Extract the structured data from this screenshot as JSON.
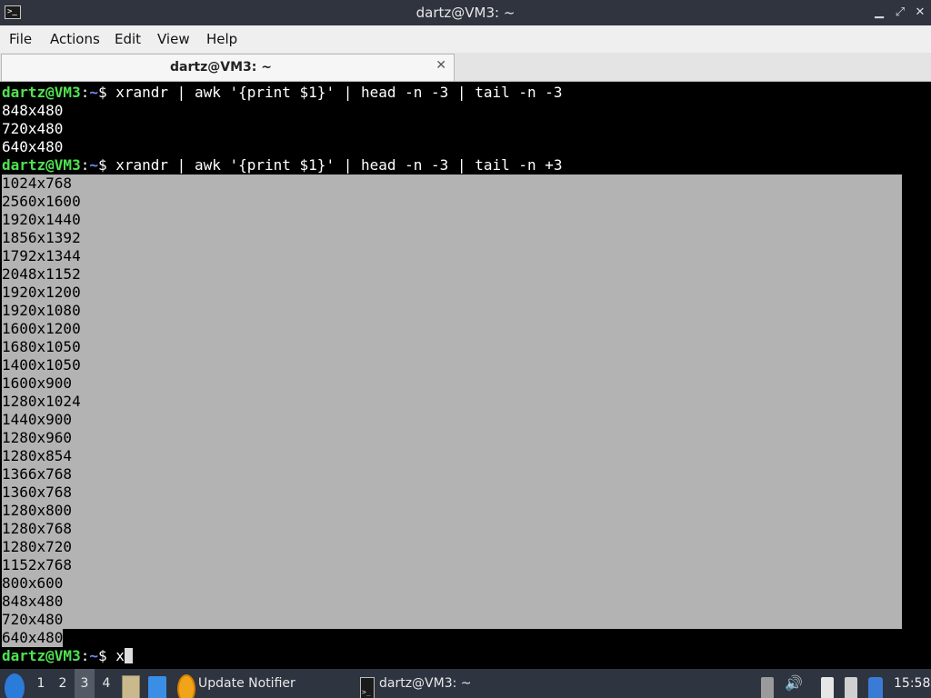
{
  "window": {
    "title": "dartz@VM3: ~",
    "controls": {
      "minimize": "▁",
      "restore": "⤢",
      "close": "✕"
    }
  },
  "menubar": {
    "items": [
      "File",
      "Actions",
      "Edit",
      "View",
      "Help"
    ]
  },
  "tabs": [
    {
      "title": "dartz@VM3: ~",
      "close": "✕"
    }
  ],
  "terminal": {
    "prompt": {
      "user_host": "dartz@VM3",
      "colon": ":",
      "dir": "~",
      "symbol": "$ "
    },
    "commands": [
      "xrandr | awk '{print $1}' | head -n -3 | tail -n -3",
      "xrandr | awk '{print $1}' | head -n -3 | tail -n +3",
      "x"
    ],
    "output1": [
      "848x480",
      "720x480",
      "640x480"
    ],
    "output2": [
      "1024x768",
      "2560x1600",
      "1920x1440",
      "1856x1392",
      "1792x1344",
      "2048x1152",
      "1920x1200",
      "1920x1080",
      "1600x1200",
      "1680x1050",
      "1400x1050",
      "1600x900",
      "1280x1024",
      "1440x900",
      "1280x960",
      "1280x854",
      "1366x768",
      "1360x768",
      "1280x800",
      "1280x768",
      "1280x720",
      "1152x768",
      "800x600",
      "848x480",
      "720x480",
      "640x480"
    ]
  },
  "taskbar": {
    "workspaces": [
      "1",
      "2",
      "3",
      "4"
    ],
    "active_workspace": "3",
    "tasks": [
      {
        "label": "Update Notifier",
        "icon": "update-notifier-icon"
      },
      {
        "label": "dartz@VM3: ~",
        "icon": "terminal-icon"
      }
    ],
    "clock": "15:58"
  }
}
